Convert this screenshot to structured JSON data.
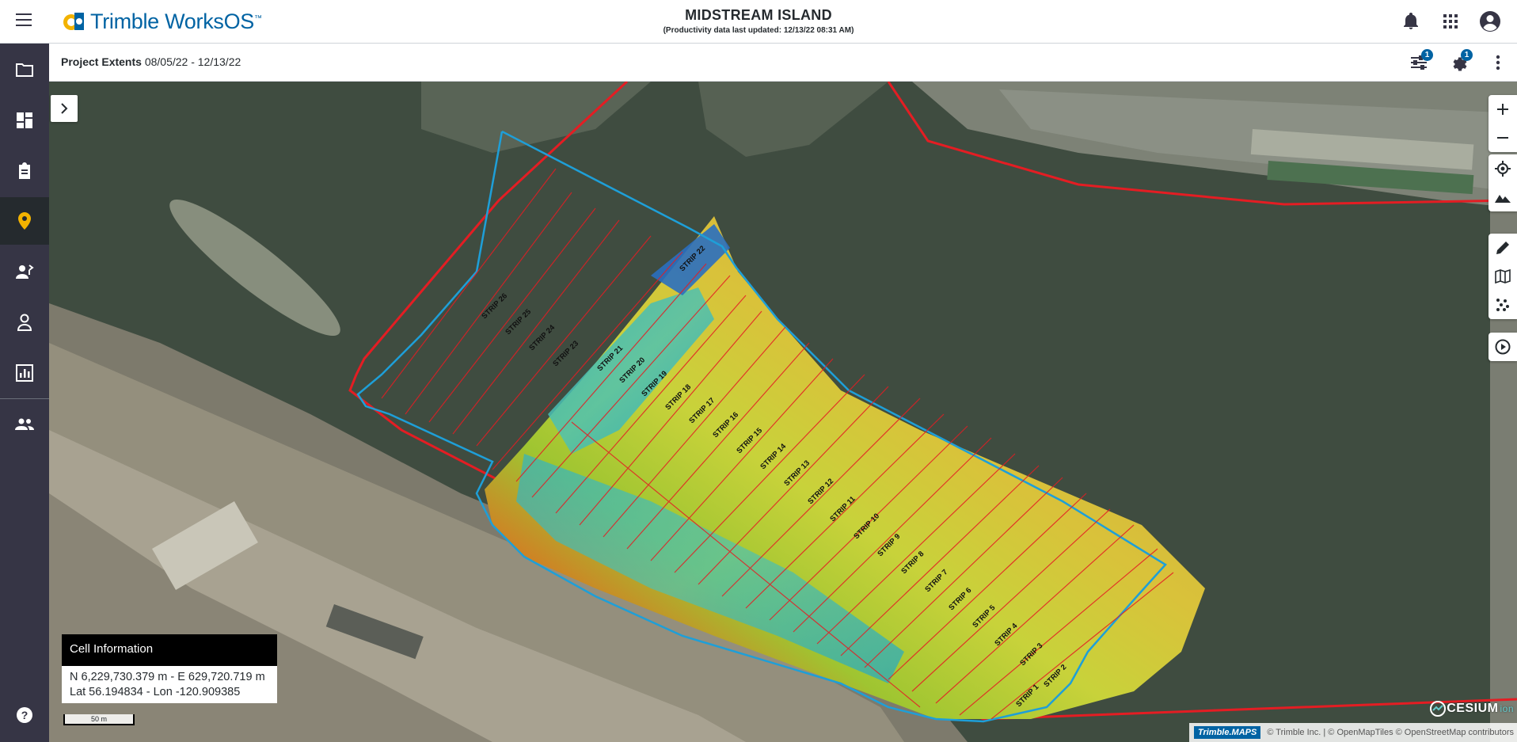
{
  "app": {
    "brand": "Trimble WorksOS",
    "brand_main": "Trimble WorksOS",
    "brand_sup": "™"
  },
  "header": {
    "title": "MIDSTREAM ISLAND",
    "subtitle": "(Productivity data last updated: 12/13/22 08:31 AM)",
    "icons": [
      "bell-icon",
      "apps-grid-icon",
      "account-circle-icon"
    ]
  },
  "sidebar": {
    "items": [
      {
        "name": "projects",
        "icon": "folder-icon"
      },
      {
        "name": "dashboard",
        "icon": "dashboard-icon"
      },
      {
        "name": "tasks",
        "icon": "clipboard-icon"
      },
      {
        "name": "map",
        "icon": "map-pin-icon",
        "active": true
      },
      {
        "name": "crew",
        "icon": "worker-icon"
      },
      {
        "name": "users",
        "icon": "person-icon"
      },
      {
        "name": "reports",
        "icon": "bar-chart-icon"
      },
      {
        "name": "teams",
        "icon": "people-icon"
      }
    ],
    "help_icon": "help-circle-icon"
  },
  "subheader": {
    "label": "Project Extents",
    "date_range": "08/05/22 - 12/13/22",
    "filter_badge": "1",
    "settings_badge": "1"
  },
  "map": {
    "strips": [
      "STRIP 1",
      "STRIP 2",
      "STRIP 3",
      "STRIP 4",
      "STRIP 5",
      "STRIP 6",
      "STRIP 7",
      "STRIP 8",
      "STRIP 9",
      "STRIP 10",
      "STRIP 11",
      "STRIP 12",
      "STRIP 13",
      "STRIP 14",
      "STRIP 15",
      "STRIP 16",
      "STRIP 17",
      "STRIP 18",
      "STRIP 19",
      "STRIP 20",
      "STRIP 21",
      "STRIP 22",
      "STRIP 23",
      "STRIP 24",
      "STRIP 25",
      "STRIP 26"
    ],
    "colors": {
      "boundary": "#e41d23",
      "extent": "#1e9fd8",
      "water": "#3f4c40"
    },
    "tools": [
      "zoom-in-icon",
      "zoom-out-icon",
      "locate-icon",
      "terrain-icon",
      "pencil-icon",
      "map-layers-icon",
      "points-icon",
      "play-circle-icon"
    ]
  },
  "cell_info": {
    "title": "Cell Information",
    "line1": "N 6,229,730.379 m - E 629,720.719 m",
    "line2": "Lat 56.194834 - Lon -120.909385"
  },
  "scale": {
    "label": "50 m"
  },
  "attribution": {
    "cesium": "CESIUM",
    "cesium_ion": "ion",
    "trimble_maps": "Trimble.MAPS",
    "text": "© Trimble Inc. | © OpenMapTiles © OpenStreetMap contributors"
  }
}
